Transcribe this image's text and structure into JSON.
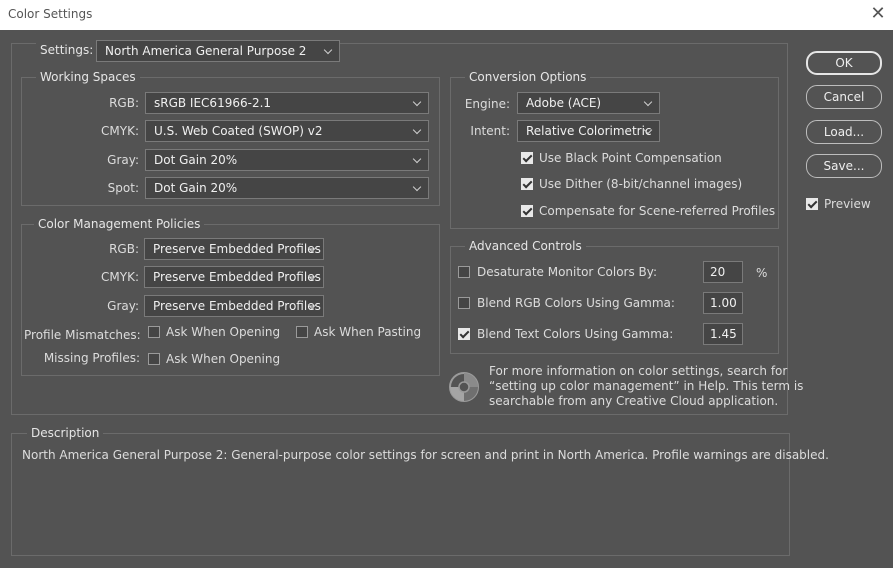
{
  "window": {
    "title": "Color Settings",
    "close_glyph": "✕"
  },
  "settings": {
    "label": "Settings:",
    "value": "North America General Purpose 2"
  },
  "working_spaces": {
    "title": "Working Spaces",
    "rgb": {
      "label": "RGB:",
      "value": "sRGB IEC61966-2.1"
    },
    "cmyk": {
      "label": "CMYK:",
      "value": "U.S. Web Coated (SWOP) v2"
    },
    "gray": {
      "label": "Gray:",
      "value": "Dot Gain 20%"
    },
    "spot": {
      "label": "Spot:",
      "value": "Dot Gain 20%"
    }
  },
  "policies": {
    "title": "Color Management Policies",
    "rgb": {
      "label": "RGB:",
      "value": "Preserve Embedded Profiles"
    },
    "cmyk": {
      "label": "CMYK:",
      "value": "Preserve Embedded Profiles"
    },
    "gray": {
      "label": "Gray:",
      "value": "Preserve Embedded Profiles"
    },
    "mismatches": {
      "label": "Profile Mismatches:",
      "ask_opening": "Ask When Opening",
      "ask_pasting": "Ask When Pasting"
    },
    "missing": {
      "label": "Missing Profiles:",
      "ask_opening": "Ask When Opening"
    }
  },
  "conversion": {
    "title": "Conversion Options",
    "engine": {
      "label": "Engine:",
      "value": "Adobe (ACE)"
    },
    "intent": {
      "label": "Intent:",
      "value": "Relative Colorimetric"
    },
    "black_point": "Use Black Point Compensation",
    "dither": "Use Dither (8-bit/channel images)",
    "scene_referred": "Compensate for Scene-referred Profiles"
  },
  "advanced": {
    "title": "Advanced Controls",
    "desaturate": {
      "label": "Desaturate Monitor Colors By:",
      "value": "20",
      "unit": "%"
    },
    "blend_rgb": {
      "label": "Blend RGB Colors Using Gamma:",
      "value": "1.00"
    },
    "blend_text": {
      "label": "Blend Text Colors Using Gamma:",
      "value": "1.45"
    }
  },
  "info": {
    "line1": "For more information on color settings, search for",
    "line2": "“setting up color management” in Help. This term is",
    "line3": "searchable from any Creative Cloud application."
  },
  "description": {
    "title": "Description",
    "text": "North America General Purpose 2:  General-purpose color settings for screen and print in North America. Profile warnings are disabled."
  },
  "buttons": {
    "ok": "OK",
    "cancel": "Cancel",
    "load": "Load...",
    "save": "Save...",
    "preview": "Preview"
  },
  "icons": {
    "close": "close-icon",
    "chevron": "chevron-down-icon",
    "check": "checkbox-checked-icon",
    "info": "color-wheel-icon"
  }
}
